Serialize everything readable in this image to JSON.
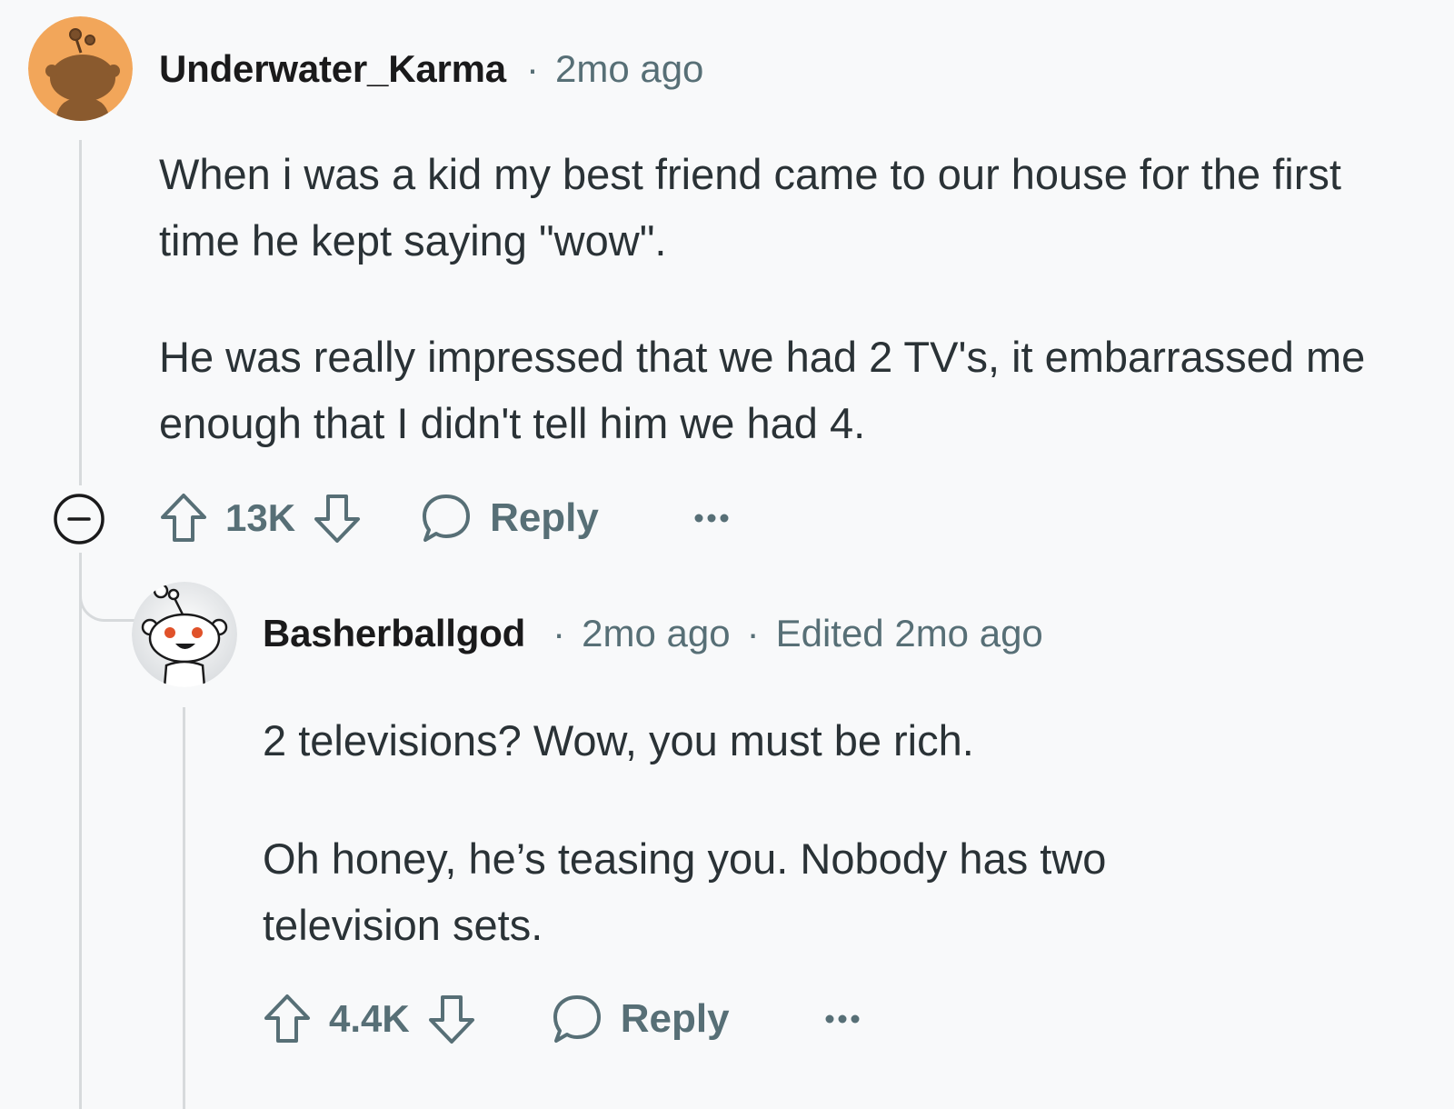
{
  "colors": {
    "background": "#f8f9fa",
    "meta_text": "#576f76",
    "body_text": "#2a3236",
    "thread_line": "#d7dadc",
    "avatar_orange": "#f2a65a"
  },
  "comments": [
    {
      "username": "Underwater_Karma",
      "separator": "·",
      "time": "2mo ago",
      "paragraphs": [
        "When i was a kid my best friend came to our house for the first time he kept saying \"wow\".",
        "He was really impressed that we had 2 TV's, it embarrassed me enough that I didn't tell him we had 4."
      ],
      "score": "13K",
      "reply_label": "Reply",
      "icons": {
        "avatar": "snoo-avatar-orange",
        "upvote": "upvote-arrow-icon",
        "downvote": "downvote-arrow-icon",
        "reply": "speech-bubble-icon",
        "more": "ellipsis-icon",
        "collapse": "collapse-minus-icon"
      }
    },
    {
      "username": "Basherballgod",
      "separator": "·",
      "time": "2mo ago",
      "separator2": "·",
      "edited": "Edited 2mo ago",
      "paragraphs": [
        "2 televisions? Wow, you must be rich.",
        "Oh honey, he’s teasing you. Nobody has two television sets."
      ],
      "score": "4.4K",
      "reply_label": "Reply",
      "icons": {
        "avatar": "snoo-avatar-white",
        "upvote": "upvote-arrow-icon",
        "downvote": "downvote-arrow-icon",
        "reply": "speech-bubble-icon",
        "more": "ellipsis-icon"
      }
    }
  ]
}
